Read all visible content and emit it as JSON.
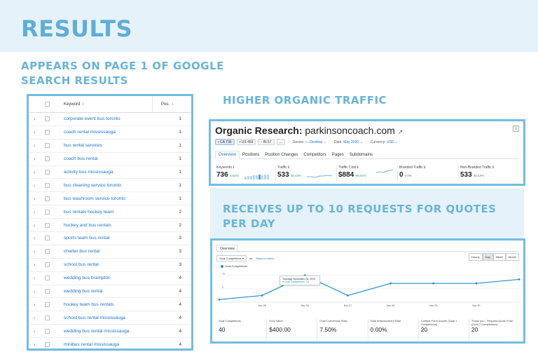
{
  "banner": {
    "title": "RESULTS"
  },
  "headings": {
    "page1": "APPEARS ON PAGE 1 OF GOOGLE SEARCH RESULTS",
    "traffic": "HIGHER ORGANIC TRAFFIC",
    "quotes": "RECEIVES UP TO 10 REQUESTS FOR QUOTES PER DAY"
  },
  "keyword_table": {
    "col_keyword": "Keyword",
    "col_pos": "Pos.",
    "rows": [
      {
        "keyword": "corporate event bus toronto",
        "pos": "1"
      },
      {
        "keyword": "coach rental mississauga",
        "pos": "1"
      },
      {
        "keyword": "bus rental services",
        "pos": "1"
      },
      {
        "keyword": "coach bus rental",
        "pos": "1"
      },
      {
        "keyword": "activity bus mississauga",
        "pos": "1"
      },
      {
        "keyword": "bus cleaning service toronto",
        "pos": "1"
      },
      {
        "keyword": "bus washroom service toronto",
        "pos": "1"
      },
      {
        "keyword": "bus rentals hockey team",
        "pos": "2"
      },
      {
        "keyword": "hockey and bus rentals",
        "pos": "2"
      },
      {
        "keyword": "sports team bus rental",
        "pos": "3"
      },
      {
        "keyword": "charter bus rental",
        "pos": "3"
      },
      {
        "keyword": "school bus rental",
        "pos": "3"
      },
      {
        "keyword": "wedding bus brampton",
        "pos": "4"
      },
      {
        "keyword": "wedding bus rental",
        "pos": "4"
      },
      {
        "keyword": "hockey team bus rentals",
        "pos": "4"
      },
      {
        "keyword": "school bus rental mississauga",
        "pos": "4"
      },
      {
        "keyword": "wedding bus rental mississauga",
        "pos": "4"
      },
      {
        "keyword": "minibus rental mississauga",
        "pos": "4"
      }
    ]
  },
  "organic": {
    "title_bold": "Organic Research:",
    "domain": "parkinsoncoach.com",
    "databases": [
      "CA 736",
      "US 459",
      "IN 57",
      "..."
    ],
    "device_label": "Device:",
    "device_value": "Desktop",
    "date_label": "Date:",
    "date_value": "May 2020",
    "currency_label": "Currency:",
    "currency_value": "USD",
    "tabs": [
      "Overview",
      "Positions",
      "Position Changes",
      "Competitors",
      "Pages",
      "Subdomains"
    ],
    "metrics": [
      {
        "label": "Keywords",
        "value": "736",
        "change": "6.62%"
      },
      {
        "label": "Traffic",
        "value": "533",
        "change": "46.43%"
      },
      {
        "label": "Traffic Cost",
        "value": "$884",
        "change": "96.01%"
      },
      {
        "label": "Branded Traffic",
        "value": "0",
        "change": "0.0%"
      },
      {
        "label": "Non-Branded Traffic",
        "value": "533",
        "change": "46.43%"
      }
    ]
  },
  "analytics": {
    "tab": "Overview",
    "metric_select": "Goal Completions",
    "vs": "vs.",
    "select_metric": "Select a metric",
    "granularity": [
      "Hourly",
      "Day",
      "Week",
      "Month"
    ],
    "legend": "Goal Completions",
    "tooltip_line1": "Tuesday, November 26, 2019",
    "tooltip_line2": "Goal Completions: 10",
    "kpis": [
      {
        "label": "Goal Completions",
        "value": "40"
      },
      {
        "label": "Goal Value",
        "value": "$400.00"
      },
      {
        "label": "Goal Conversion Rate",
        "value": "7.50%"
      },
      {
        "label": "Total Abandonment Rate",
        "value": "0.00%"
      },
      {
        "label": "Contact Form Inquire (Goal 1 Completions)",
        "value": "20"
      },
      {
        "label": "Thank you - Request Quote Form (Goal 2 Completions)",
        "value": "20"
      }
    ]
  },
  "chart_data": {
    "type": "line",
    "x": [
      "Nov 24",
      "Nov 25",
      "Nov 26",
      "Nov 27",
      "Nov 28",
      "Nov 29",
      "Nov 30",
      "Dec 1"
    ],
    "xticks": [
      "Nov 25",
      "Nov 26",
      "Nov 27",
      "Nov 28",
      "Nov 29",
      "Nov 30"
    ],
    "series": [
      {
        "name": "Goal Completions",
        "values": [
          1,
          2.5,
          10,
          2.5,
          7,
          7,
          7,
          8.5
        ]
      }
    ],
    "ylim": [
      0,
      12
    ],
    "yticks": [
      "10",
      "5"
    ],
    "color": "#1f8fc5"
  },
  "colors": {
    "accent": "#73bde2",
    "heading": "#68b4dc",
    "link": "#1a73c8",
    "positive": "#2ba84a"
  }
}
